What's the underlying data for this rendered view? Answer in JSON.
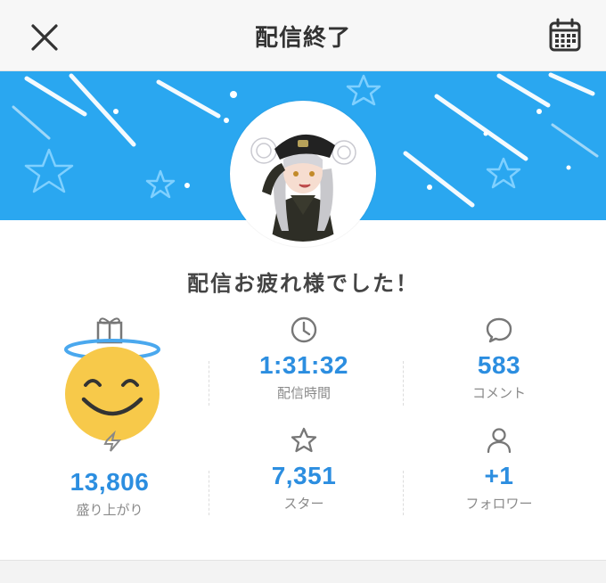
{
  "header": {
    "title": "配信終了"
  },
  "message": "配信お疲れ様でした！",
  "stats": {
    "excitement": {
      "value": "13,806",
      "label": "盛り上がり"
    },
    "duration": {
      "value": "1:31:32",
      "label": "配信時間"
    },
    "comments": {
      "value": "583",
      "label": "コメント"
    },
    "stars": {
      "value": "7,351",
      "label": "スター"
    },
    "followers": {
      "value": "+1",
      "label": "フォロワー"
    }
  },
  "colors": {
    "banner": "#2aa7f0",
    "accent": "#2c8ee0",
    "label": "#8a8a8a"
  },
  "icons": [
    "close-icon",
    "calendar-icon",
    "clock-icon",
    "comment-bubble-icon",
    "star-icon",
    "person-icon",
    "smiling-angel-face-icon"
  ]
}
